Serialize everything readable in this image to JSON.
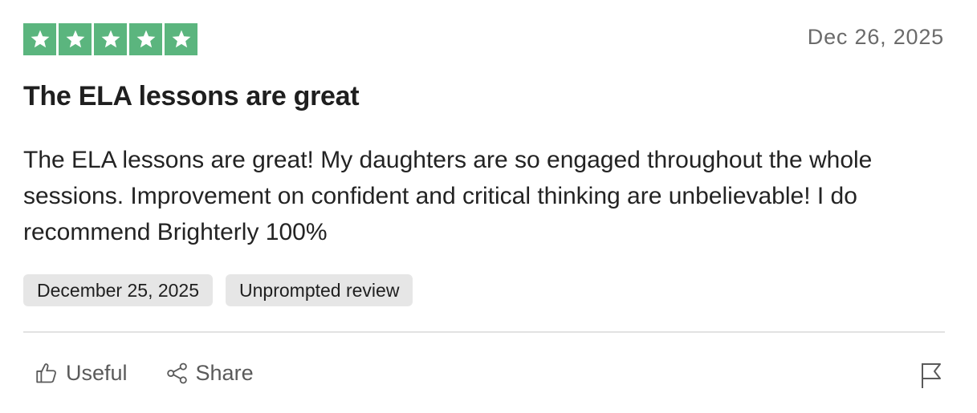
{
  "review": {
    "rating": 5,
    "rating_max": 5,
    "star_color": "#5bb57e",
    "date": "Dec 26, 2025",
    "title": "The ELA lessons are great",
    "body": "The ELA lessons are great! My daughters are so engaged throughout the whole sessions. Improvement on confident and critical thinking are unbelievable! I do recommend Brighterly 100%",
    "tags": [
      "December 25, 2025",
      "Unprompted review"
    ]
  },
  "actions": {
    "useful_label": "Useful",
    "useful_icon": "thumbs-up-icon",
    "share_label": "Share",
    "share_icon": "share-icon",
    "report_icon": "flag-icon"
  }
}
